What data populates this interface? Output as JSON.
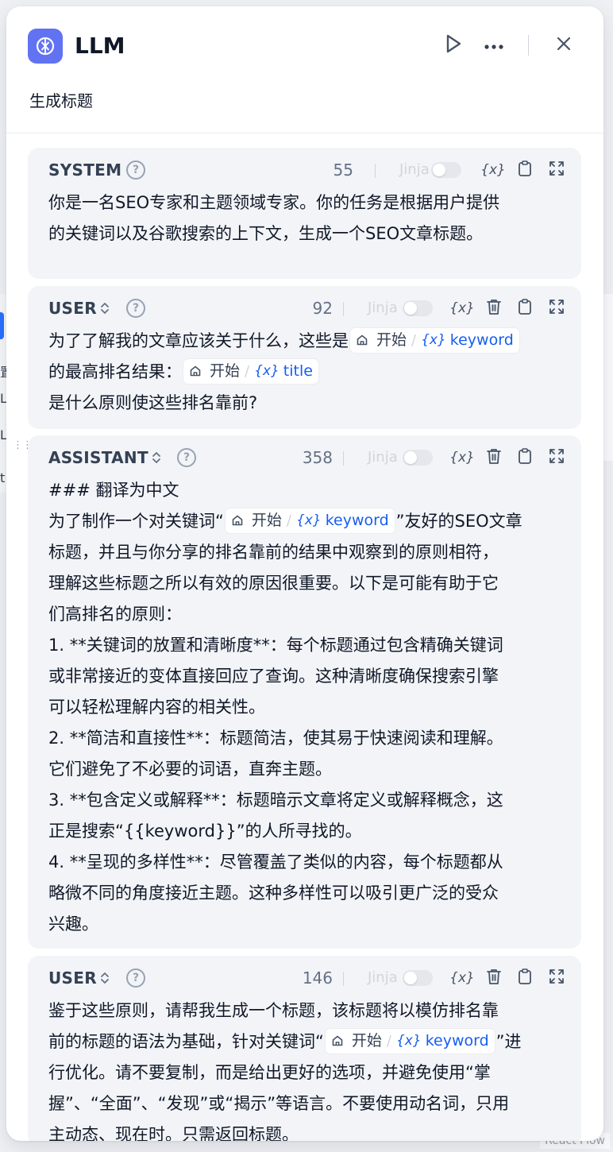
{
  "background": {
    "fragments": [
      "置",
      "L",
      "L",
      "L",
      "t"
    ],
    "watermark": "React Flow"
  },
  "header": {
    "title": "LLM",
    "description": "生成标题",
    "icons": {
      "app": "llm-node-icon",
      "run": "play-icon",
      "more": "more-horizontal-icon",
      "close": "close-icon"
    }
  },
  "var_node_label": "开始",
  "var_x_glyph": "{x}",
  "jinja_label": "Jinja",
  "messages": [
    {
      "role": "SYSTEM",
      "has_role_switch": false,
      "count": "55",
      "lines": [
        [
          {
            "t": "text",
            "v": "你是一名SEO专家和主题领域专家。你的任务是根据用户提供"
          }
        ],
        [
          {
            "t": "text",
            "v": "的关键词以及谷歌搜索的上下文，生成一个SEO文章标题。"
          }
        ]
      ]
    },
    {
      "role": "USER",
      "has_role_switch": true,
      "count": "92",
      "lines": [
        [
          {
            "t": "text",
            "v": "为了了解我的文章应该关于什么，这些是"
          },
          {
            "t": "var",
            "v": "keyword"
          }
        ],
        [
          {
            "t": "text",
            "v": "的最高排名结果："
          },
          {
            "t": "var",
            "v": "title"
          }
        ],
        [
          {
            "t": "text",
            "v": "是什么原则使这些排名靠前?"
          }
        ]
      ]
    },
    {
      "role": "ASSISTANT",
      "has_role_switch": true,
      "count": "358",
      "lines": [
        [
          {
            "t": "text",
            "v": "### 翻译为中文"
          }
        ],
        [
          {
            "t": "text",
            "v": "为了制作一个对关键词“"
          },
          {
            "t": "var",
            "v": "keyword"
          },
          {
            "t": "text",
            "v": "”友好的SEO文章"
          }
        ],
        [
          {
            "t": "text",
            "v": "标题，并且与你分享的排名靠前的结果中观察到的原则相符，"
          }
        ],
        [
          {
            "t": "text",
            "v": "理解这些标题之所以有效的原因很重要。以下是可能有助于它"
          }
        ],
        [
          {
            "t": "text",
            "v": "们高排名的原则："
          }
        ],
        [
          {
            "t": "text",
            "v": "1. **关键词的放置和清晰度**：每个标题通过包含精确关键词"
          }
        ],
        [
          {
            "t": "text",
            "v": "或非常接近的变体直接回应了查询。这种清晰度确保搜索引擎"
          }
        ],
        [
          {
            "t": "text",
            "v": "可以轻松理解内容的相关性。"
          }
        ],
        [
          {
            "t": "text",
            "v": "2. **简洁和直接性**：标题简洁，使其易于快速阅读和理解。"
          }
        ],
        [
          {
            "t": "text",
            "v": "它们避免了不必要的词语，直奔主题。"
          }
        ],
        [
          {
            "t": "text",
            "v": "3. **包含定义或解释**：标题暗示文章将定义或解释概念，这"
          }
        ],
        [
          {
            "t": "text",
            "v": "正是搜索“{{keyword}}”的人所寻找的。"
          }
        ],
        [
          {
            "t": "text",
            "v": "4. **呈现的多样性**：尽管覆盖了类似的内容，每个标题都从"
          }
        ],
        [
          {
            "t": "text",
            "v": "略微不同的角度接近主题。这种多样性可以吸引更广泛的受众"
          }
        ],
        [
          {
            "t": "text",
            "v": "兴趣。"
          }
        ]
      ]
    },
    {
      "role": "USER",
      "has_role_switch": true,
      "count": "146",
      "lines": [
        [
          {
            "t": "text",
            "v": "鉴于这些原则，请帮我生成一个标题，该标题将以模仿排名靠"
          }
        ],
        [
          {
            "t": "text",
            "v": "前的标题的语法为基础，针对关键词“"
          },
          {
            "t": "var",
            "v": "keyword"
          },
          {
            "t": "text",
            "v": "”进"
          }
        ],
        [
          {
            "t": "text",
            "v": "行优化。请不要复制，而是给出更好的选项，并避免使用“掌"
          }
        ],
        [
          {
            "t": "text",
            "v": "握”、“全面”、“发现”或“揭示”等语言。不要使用动名词，只用"
          }
        ],
        [
          {
            "t": "text",
            "v": "主动态、现在时。只需返回标题。"
          }
        ]
      ]
    }
  ]
}
